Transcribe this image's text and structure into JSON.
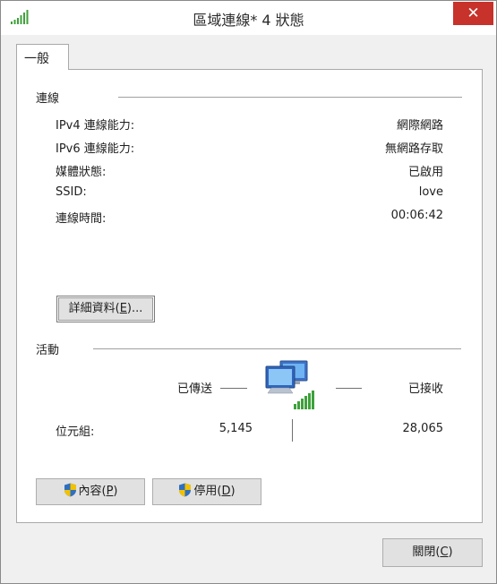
{
  "window": {
    "title": "區域連線* 4 狀態",
    "app_icon": "wifi-signal-icon",
    "close_glyph": "✕"
  },
  "tabs": [
    {
      "label": "一般"
    }
  ],
  "connection": {
    "title": "連線",
    "rows": [
      {
        "label": "IPv4 連線能力:",
        "value": "網際網路"
      },
      {
        "label": "IPv6 連線能力:",
        "value": "無網路存取"
      },
      {
        "label": "媒體狀態:",
        "value": "已啟用"
      },
      {
        "label": "SSID:",
        "value": "love"
      },
      {
        "label": "連線時間:",
        "value": "00:06:42"
      }
    ],
    "details_button": {
      "pre": "詳細資料(",
      "key": "E",
      "post": ")..."
    }
  },
  "activity": {
    "title": "活動",
    "sent_label": "已傳送",
    "received_label": "已接收",
    "bytes_label": "位元組:",
    "bytes_sent": "5,145",
    "bytes_received": "28,065",
    "network_icon": "network-computers-icon"
  },
  "buttons": {
    "properties": {
      "pre": "內容(",
      "key": "P",
      "post": ")"
    },
    "disable": {
      "pre": "停用(",
      "key": "D",
      "post": ")"
    },
    "close": {
      "pre": "關閉(",
      "key": "C",
      "post": ")"
    }
  },
  "colors": {
    "signal_green": "#3ea13a",
    "close_red": "#c7322b",
    "shield_blue": "#2f6fc0",
    "shield_yellow": "#f2c200"
  }
}
